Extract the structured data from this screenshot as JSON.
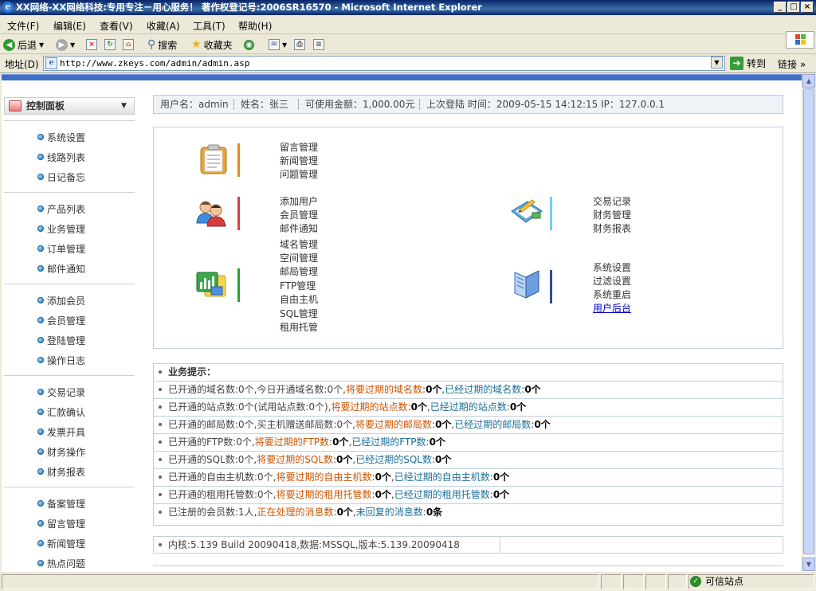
{
  "window": {
    "title": "XX网络-XX网络科技:专用专注－用心服务！ 著作权登记号:2006SR16570 - Microsoft Internet Explorer",
    "controls": [
      "_",
      "□",
      "×"
    ]
  },
  "menu": [
    "文件(F)",
    "编辑(E)",
    "查看(V)",
    "收藏(A)",
    "工具(T)",
    "帮助(H)"
  ],
  "toolbar": {
    "back": "后退",
    "search": "搜索",
    "favorites": "收藏夹"
  },
  "address": {
    "label": "地址(D)",
    "url": "http://www.zkeys.com/admin/admin.asp",
    "go": "转到",
    "links": "链接"
  },
  "status": {
    "zone": "可信站点"
  },
  "sidebar": {
    "header": "控制面板",
    "groups": [
      [
        "系统设置",
        "线路列表",
        "日记备忘"
      ],
      [
        "产品列表",
        "业务管理",
        "订单管理",
        "邮件通知"
      ],
      [
        "添加会员",
        "会员管理",
        "登陆管理",
        "操作日志"
      ],
      [
        "交易记录",
        "汇款确认",
        "发票开具",
        "财务操作",
        "财务报表"
      ],
      [
        "备案管理",
        "留言管理",
        "新闻管理",
        "热点问题"
      ]
    ]
  },
  "info": {
    "user": "用户名：admin",
    "name": "姓名：张三",
    "balance": "可使用金额：1,000.00元",
    "lastlogin": "上次登陆 时间：2009-05-15 14:12:15 IP：127.0.0.1"
  },
  "panel": {
    "group1": [
      "留言管理",
      "新闻管理",
      "问题管理"
    ],
    "group2": [
      "添加用户",
      "会员管理",
      "邮件通知"
    ],
    "group3": [
      "域名管理",
      "空间管理",
      "邮局管理",
      "FTP管理",
      "自由主机",
      "SQL管理",
      "租用托管"
    ],
    "group4": [
      "交易记录",
      "财务管理",
      "财务报表"
    ],
    "group5": [
      "系统设置",
      "过滤设置",
      "系统重启",
      "用户后台"
    ],
    "colors": {
      "bar1": "#e48a16",
      "bar2": "#e03c3c",
      "bar3": "#21a52a",
      "bar4": "#6fd0ee",
      "bar5": "#2b4f9e"
    }
  },
  "tips": {
    "title": "业务提示：",
    "rows": [
      [
        [
          "已开通的域名数:0个,今日开通域名数:0个,",
          "n"
        ],
        [
          "将要过期的域名数",
          "o"
        ],
        [
          ":",
          "n"
        ],
        [
          "0个",
          "k"
        ],
        [
          ",",
          "n"
        ],
        [
          "已经过期的域名数",
          "b"
        ],
        [
          ":",
          "n"
        ],
        [
          "0个",
          "k"
        ]
      ],
      [
        [
          "已开通的站点数:0个(试用站点数:0个),",
          "n"
        ],
        [
          "将要过期的站点数",
          "o"
        ],
        [
          ":",
          "n"
        ],
        [
          "0个",
          "k"
        ],
        [
          ",",
          "n"
        ],
        [
          "已经过期的站点数",
          "b"
        ],
        [
          ":",
          "n"
        ],
        [
          "0个",
          "k"
        ]
      ],
      [
        [
          "已开通的邮局数:0个,买主机赠送邮局数:0个,",
          "n"
        ],
        [
          "将要过期的邮局数",
          "o"
        ],
        [
          ":",
          "n"
        ],
        [
          "0个",
          "k"
        ],
        [
          ",",
          "n"
        ],
        [
          "已经过期的邮局数",
          "b"
        ],
        [
          ":",
          "n"
        ],
        [
          "0个",
          "k"
        ]
      ],
      [
        [
          "已开通的FTP数:0个,",
          "n"
        ],
        [
          "将要过期的FTP数",
          "o"
        ],
        [
          ":",
          "n"
        ],
        [
          "0个",
          "k"
        ],
        [
          ",",
          "n"
        ],
        [
          "已经过期的FTP数",
          "b"
        ],
        [
          ":",
          "n"
        ],
        [
          "0个",
          "k"
        ]
      ],
      [
        [
          "已开通的SQL数:0个,",
          "n"
        ],
        [
          "将要过期的SQL数",
          "o"
        ],
        [
          ":",
          "n"
        ],
        [
          "0个",
          "k"
        ],
        [
          ",",
          "n"
        ],
        [
          "已经过期的SQL数",
          "b"
        ],
        [
          ":",
          "n"
        ],
        [
          "0个",
          "k"
        ]
      ],
      [
        [
          "已开通的自由主机数:0个,",
          "n"
        ],
        [
          "将要过期的自由主机数",
          "o"
        ],
        [
          ":",
          "n"
        ],
        [
          "0个",
          "k"
        ],
        [
          ",",
          "n"
        ],
        [
          "已经过期的自由主机数",
          "b"
        ],
        [
          ":",
          "n"
        ],
        [
          "0个",
          "k"
        ]
      ],
      [
        [
          "已开通的租用托管数:0个,",
          "n"
        ],
        [
          "将要过期的租用托管数",
          "o"
        ],
        [
          ":",
          "n"
        ],
        [
          "0个",
          "k"
        ],
        [
          ",",
          "n"
        ],
        [
          "已经过期的租用托管数",
          "b"
        ],
        [
          ":",
          "n"
        ],
        [
          "0个",
          "k"
        ]
      ],
      [
        [
          "已注册的会员数:1人,",
          "n"
        ],
        [
          "正在处理的消息数",
          "o"
        ],
        [
          ":",
          "n"
        ],
        [
          "0个",
          "k"
        ],
        [
          ",",
          "n"
        ],
        [
          "未回复的消息数",
          "b"
        ],
        [
          ":",
          "n"
        ],
        [
          "0条",
          "k"
        ]
      ]
    ]
  },
  "version": "内核:5.139 Build 20090418,数据:MSSQL,版本:5.139.20090418"
}
